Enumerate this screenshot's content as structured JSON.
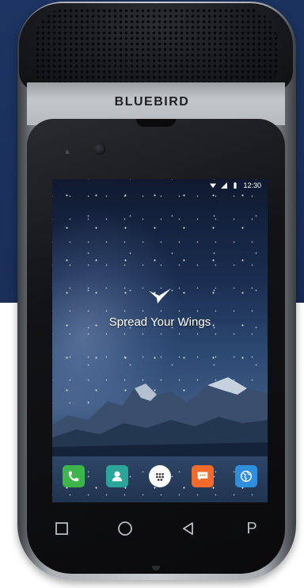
{
  "device": {
    "brand": "BLUEBIRD"
  },
  "status_bar": {
    "time": "12:30",
    "icons": [
      "wifi-icon",
      "signal-icon",
      "battery-icon"
    ]
  },
  "home_screen": {
    "tagline": "Spread Your Wings",
    "dock_apps": [
      {
        "name": "phone-icon",
        "color": "#3cb54a"
      },
      {
        "name": "contacts-icon",
        "color": "#2aa59a"
      },
      {
        "name": "app-drawer-icon",
        "color": "#ffffff"
      },
      {
        "name": "messages-icon",
        "color": "#f26b2a"
      },
      {
        "name": "browser-icon",
        "color": "#2f8fdd"
      }
    ]
  },
  "nav_keys": {
    "icons": [
      "recents-icon",
      "home-icon",
      "back-icon"
    ],
    "p_key_label": "P"
  },
  "colors": {
    "background_top": "#1a2f5a",
    "background_bottom": "#ffffff"
  }
}
